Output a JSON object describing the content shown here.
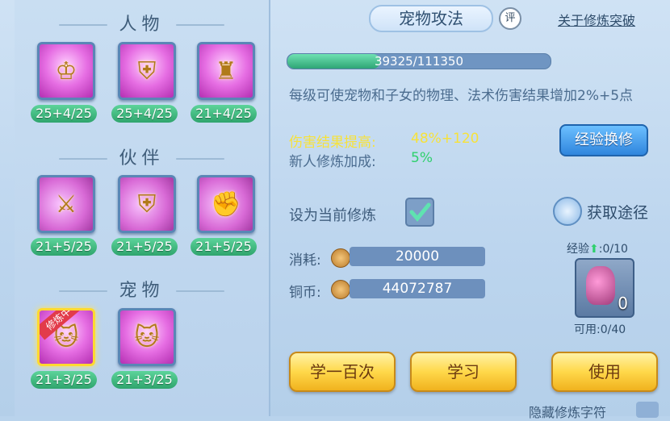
{
  "sections": {
    "person": {
      "title": "人物",
      "skills": [
        {
          "icon": "golden-armor-figure-icon",
          "level": "25+4/25"
        },
        {
          "icon": "shield-warrior-icon",
          "level": "25+4/25"
        },
        {
          "icon": "armored-knight-icon",
          "level": "21+4/25"
        }
      ]
    },
    "partner": {
      "title": "伙伴",
      "skills": [
        {
          "icon": "beast-sword-icon",
          "level": "21+5/25"
        },
        {
          "icon": "beast-shield-icon",
          "level": "21+5/25"
        },
        {
          "icon": "beast-gauntlet-icon",
          "level": "21+5/25"
        }
      ]
    },
    "pet": {
      "title": "宠物",
      "skills": [
        {
          "icon": "cat-sword-icon",
          "level": "21+3/25",
          "ribbon": "修炼中"
        },
        {
          "icon": "cat-shield-icon",
          "level": "21+3/25"
        }
      ]
    }
  },
  "header": {
    "tab_title": "宠物攻法",
    "review_badge": "评",
    "breakthrough_link": "关于修炼突破"
  },
  "progress": {
    "current": 39325,
    "max": 111350,
    "text": "39325/111350"
  },
  "description": "每级可使宠物和子女的物理、法术伤害结果增加2%+5点",
  "stats": {
    "damage_label": "伤害结果提高:",
    "damage_value": "48%+120",
    "newbie_label": "新人修炼加成:",
    "newbie_value": "5%"
  },
  "exchange_button": "经验换修",
  "set_current_label": "设为当前修炼",
  "get_path_label": "获取途径",
  "cost": {
    "label": "消耗:",
    "value": "20000"
  },
  "copper": {
    "label": "铜币:",
    "value": "44072787"
  },
  "item": {
    "exp_label": "经验",
    "exp_value": ":0/10",
    "count": "0",
    "usable": "可用:0/40"
  },
  "buttons": {
    "learn_hundred": "学一百次",
    "learn": "学习",
    "use": "使用"
  },
  "hide_label": "隐藏修炼字符",
  "colors": {
    "accent_yellow": "#f7e23a",
    "accent_green": "#2fd06d",
    "text_blue": "#4b6c8f"
  }
}
